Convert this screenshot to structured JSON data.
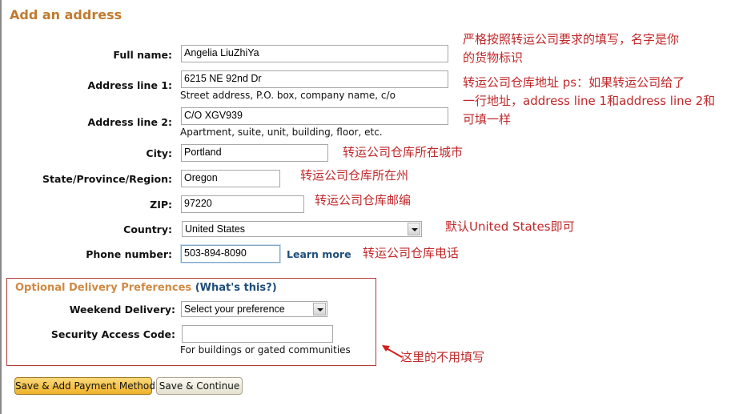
{
  "page": {
    "title": "Add an address"
  },
  "form": {
    "full_name": {
      "label": "Full name:",
      "value": "Angelia LiuZhiYa"
    },
    "address_line_1": {
      "label": "Address line 1:",
      "value": "6215 NE 92nd Dr",
      "hint": "Street address, P.O. box, company name, c/o"
    },
    "address_line_2": {
      "label": "Address line 2:",
      "value": "C/O XGV939",
      "hint": "Apartment, suite, unit, building, floor, etc."
    },
    "city": {
      "label": "City:",
      "value": "Portland"
    },
    "state": {
      "label": "State/Province/Region:",
      "value": "Oregon"
    },
    "zip": {
      "label": "ZIP:",
      "value": "97220"
    },
    "country": {
      "label": "Country:",
      "selected": "United States"
    },
    "phone": {
      "label": "Phone number:",
      "value": "503-894-8090",
      "learn_more": "Learn more"
    }
  },
  "optional": {
    "title": "Optional Delivery Preferences",
    "whats_this_open": "(",
    "whats_this": "What's this?",
    "whats_this_close": ")",
    "weekend_delivery": {
      "label": "Weekend Delivery:",
      "selected": "Select your preference"
    },
    "security_code": {
      "label": "Security Access Code:",
      "value": "",
      "hint": "For buildings or gated communities"
    }
  },
  "buttons": {
    "save_add_payment": "Save & Add Payment Method",
    "save_continue": "Save & Continue"
  },
  "annotations": {
    "full_name_line1": "严格按照转运公司要求的填写，名字是你",
    "full_name_line2": "的货物标识",
    "address_line1": "转运公司仓库地址 ps：如果转运公司给了",
    "address_line2": "一行地址，address line 1和address line 2和",
    "address_line3": "可填一样",
    "city": "转运公司仓库所在城市",
    "state": "转运公司仓库所在州",
    "zip": "转运公司仓库邮编",
    "country": "默认United States即可",
    "phone": "转运公司仓库电话",
    "optional": "这里的不用填写"
  },
  "colors": {
    "title": "#c07a2e",
    "annotation": "#c0282a",
    "link": "#1f4e79",
    "optional_border": "#b33a36",
    "primary_button": "#f0b22a"
  }
}
